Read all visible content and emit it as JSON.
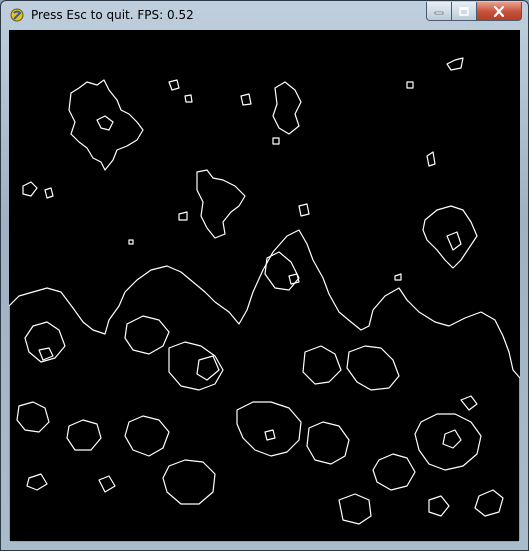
{
  "window": {
    "title": "Press Esc to quit. FPS: 0.52",
    "controls": {
      "minimize": "minimize",
      "maximize": "maximize",
      "close": "close"
    }
  },
  "colors": {
    "canvas_background": "#000000",
    "contour_stroke": "#ffffff",
    "close_button": "#c6513a"
  },
  "icons": {
    "app": "pygame-snake-icon",
    "minimize": "minimize-icon",
    "maximize": "maximize-icon",
    "close": "close-icon"
  },
  "canvas": {
    "content": "white contour lines (edge-detected terrain) on black background"
  }
}
